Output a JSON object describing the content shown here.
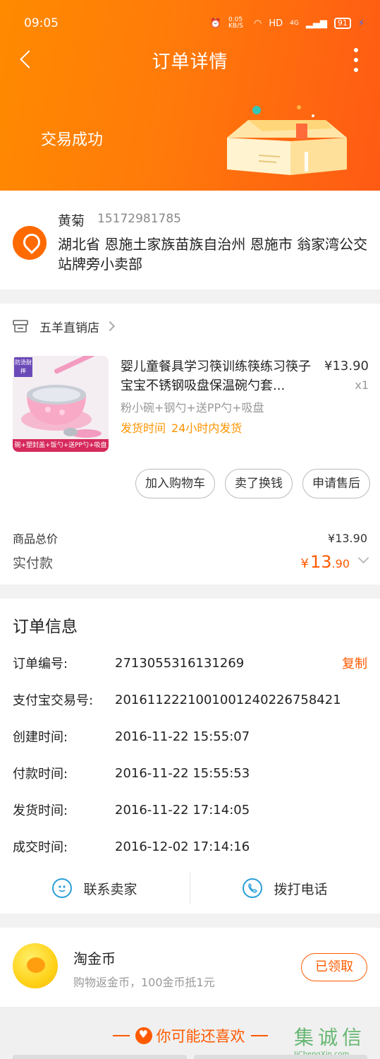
{
  "status_bar": {
    "time": "09:05",
    "net_speed": "0.05 KB/S",
    "hd": "HD",
    "signal": "4G",
    "battery": "91"
  },
  "nav": {
    "title": "订单详情"
  },
  "order_status": "交易成功",
  "address": {
    "name": "黄菊",
    "phone": "15172981785",
    "text": "湖北省 恩施土家族苗族自治州 恩施市 翁家湾公交站牌旁小卖部"
  },
  "shop": {
    "name": "五羊直销店"
  },
  "product": {
    "image_tag_top": "防烫耐摔",
    "image_tag_bottom": "碗+塑封盖+饭勺+送PP勺+吸盘",
    "title": "婴儿童餐具学习筷训练筷练习筷子宝宝不锈钢吸盘保温碗勺套...",
    "price": "¥13.90",
    "qty": "x1",
    "sku": "粉小碗+钢勺+送PP勺+吸盘",
    "ship_label": "发货时间",
    "ship_value": "24小时内发货"
  },
  "actions": [
    "加入购物车",
    "卖了换钱",
    "申请售后"
  ],
  "summary": {
    "total_label": "商品总价",
    "total_value": "¥13.90",
    "paid_label": "实付款",
    "paid_currency": "¥",
    "paid_int": "13",
    "paid_dec": ".90"
  },
  "order_info": {
    "title": "订单信息",
    "copy_label": "复制",
    "rows": [
      {
        "label": "订单编号:",
        "value": "2713055316131269"
      },
      {
        "label": "支付宝交易号:",
        "value": "2016112221001001240226758421"
      },
      {
        "label": "创建时间:",
        "value": "2016-11-22 15:55:07"
      },
      {
        "label": "付款时间:",
        "value": "2016-11-22 15:55:53"
      },
      {
        "label": "发货时间:",
        "value": "2016-11-22 17:14:05"
      },
      {
        "label": "成交时间:",
        "value": "2016-12-02 17:14:16"
      }
    ],
    "contact_seller": "联系卖家",
    "call": "拨打电话"
  },
  "coin": {
    "title": "淘金币",
    "subtitle": "购物返金币，100金币抵1元",
    "button": "已领取"
  },
  "recommend": {
    "title": "你可能还喜欢"
  },
  "watermark": {
    "main": "集诚信",
    "sub": "JiChengXin.com"
  },
  "colors": {
    "accent": "#ff5a00",
    "header_start": "#ff8a00",
    "ship": "#ff9400",
    "link_blue": "#2a9fd8"
  }
}
